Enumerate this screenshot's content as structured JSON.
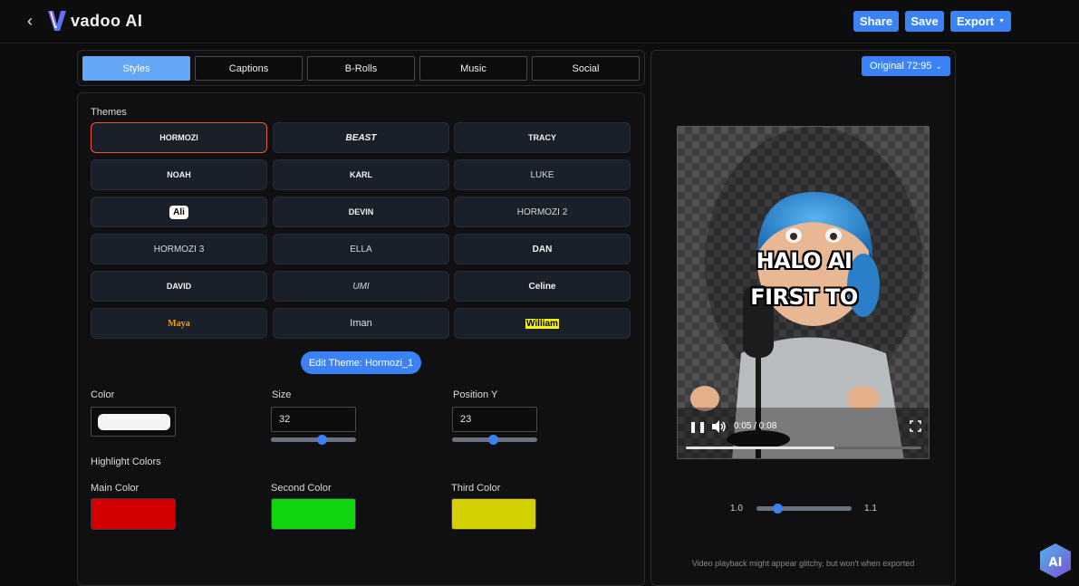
{
  "header": {
    "back_icon": "chevron-left-icon",
    "logo_text": "vadoo AI",
    "share_label": "Share",
    "save_label": "Save",
    "export_label": "Export",
    "accent": "#3b82f6"
  },
  "tabs": [
    {
      "label": "Styles",
      "active": true
    },
    {
      "label": "Captions",
      "active": false
    },
    {
      "label": "B-Rolls",
      "active": false
    },
    {
      "label": "Music",
      "active": false
    },
    {
      "label": "Social",
      "active": false
    }
  ],
  "themes": {
    "section_label": "Themes",
    "items": [
      {
        "label": "HORMOZI",
        "selected": true
      },
      {
        "label": "BEAST"
      },
      {
        "label": "TRACY"
      },
      {
        "label": "NOAH"
      },
      {
        "label": "KARL"
      },
      {
        "label": "LUKE"
      },
      {
        "label": "Ali"
      },
      {
        "label": "DEVIN"
      },
      {
        "label": "HORMOZI 2"
      },
      {
        "label": "HORMOZI 3"
      },
      {
        "label": "ELLA"
      },
      {
        "label": "DAN"
      },
      {
        "label": "DAVID"
      },
      {
        "label": "UMI"
      },
      {
        "label": "Celine"
      },
      {
        "label": "Maya"
      },
      {
        "label": "Iman"
      },
      {
        "label": "William"
      }
    ],
    "edit_button": "Edit Theme: Hormozi_1"
  },
  "style_controls": {
    "color_label": "Color",
    "color_value": "#f4f4f4",
    "size_label": "Size",
    "size_value": "32",
    "size_slider_fraction": 0.6,
    "position_label": "Position Y",
    "position_value": "23",
    "position_slider_fraction": 0.48
  },
  "highlight": {
    "section_label": "Highlight Colors",
    "main_label": "Main Color",
    "main_color": "#d40000",
    "second_label": "Second Color",
    "second_color": "#10d40e",
    "third_label": "Third Color",
    "third_color": "#d2d000"
  },
  "preview": {
    "ratio_label": "Original 72:95",
    "caption_line1": "HALO AI",
    "caption_line2": "FIRST TO",
    "time": "0:05 / 0:08",
    "progress_fraction": 0.63,
    "speed_min": "1.0",
    "speed_max": "1.1",
    "speed_fraction": 0.22,
    "note": "Video playback might appear glitchy, but won't when exported"
  }
}
